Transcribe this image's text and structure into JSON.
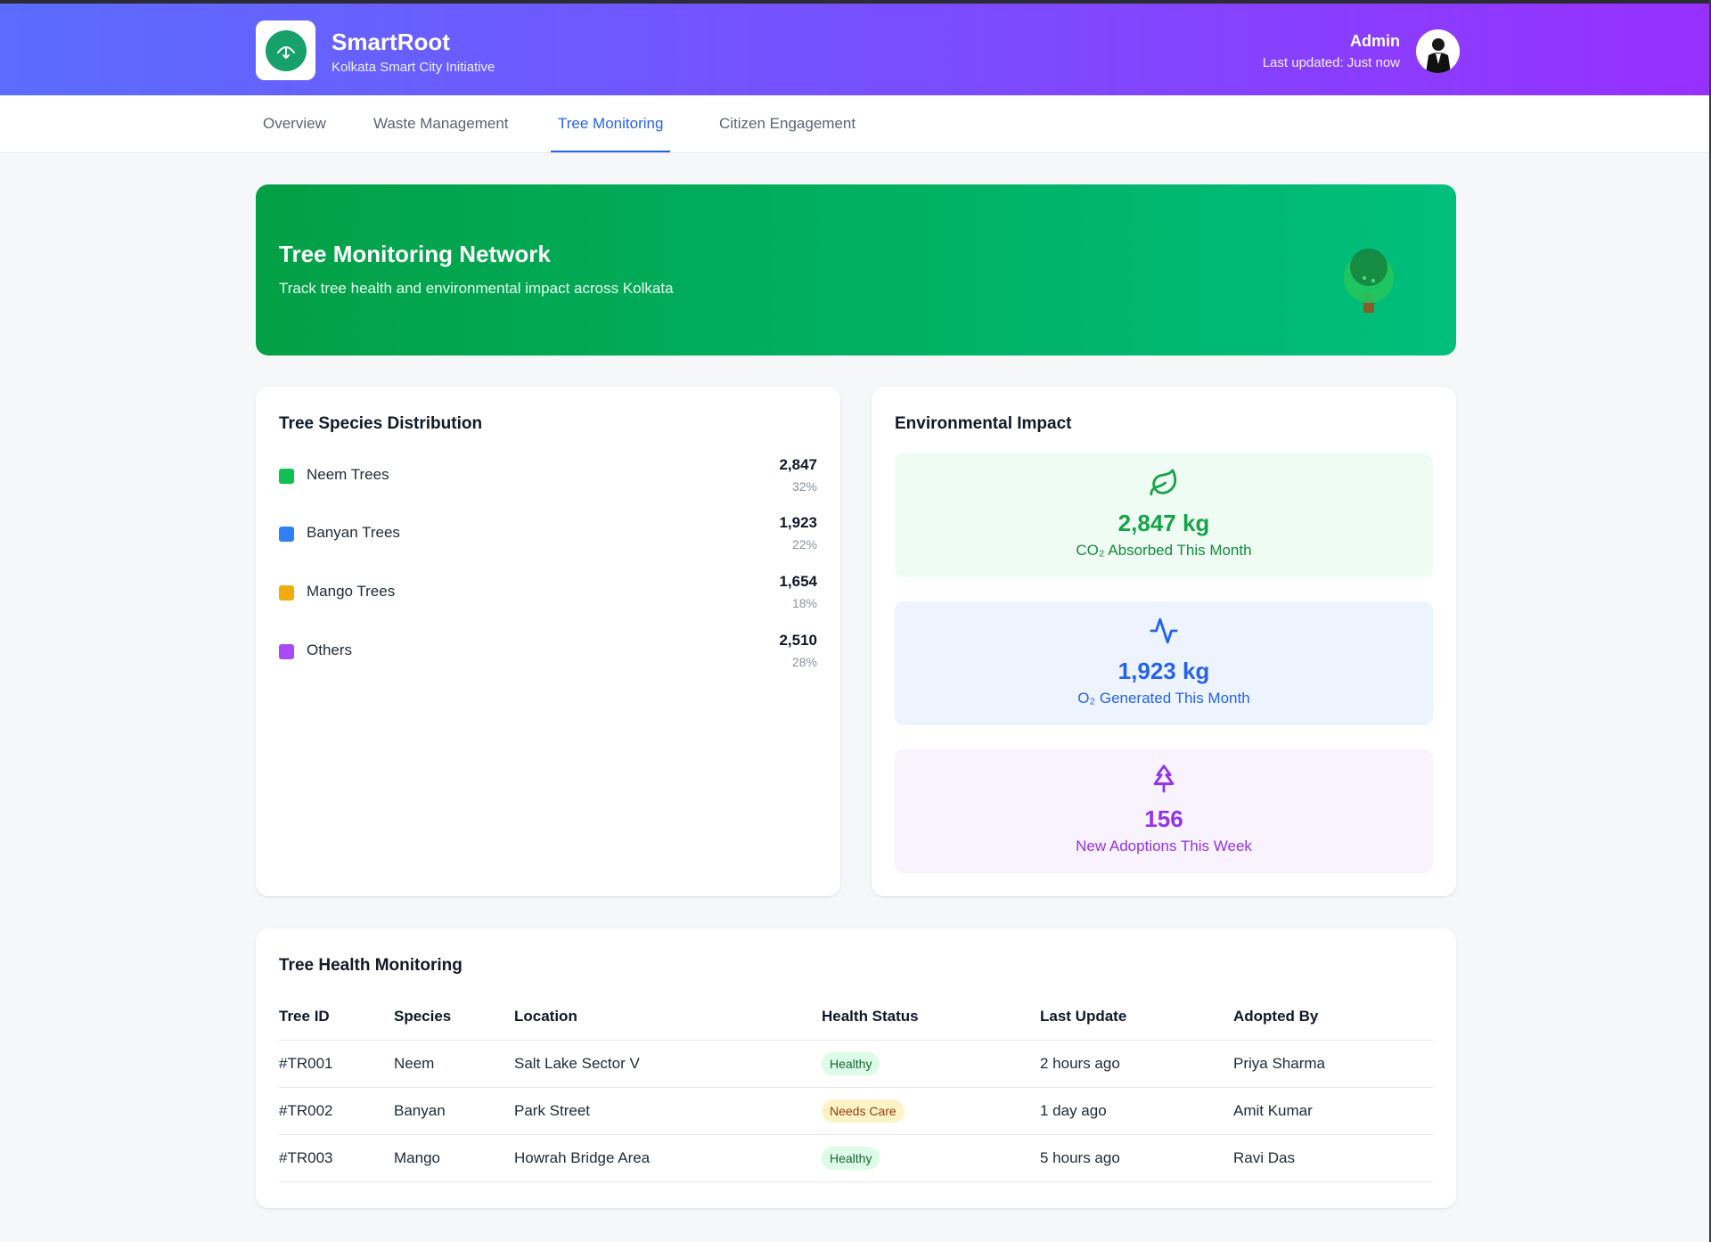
{
  "app": {
    "name": "SmartRoot",
    "subtitle": "Kolkata Smart City Initiative"
  },
  "user": {
    "name": "Admin",
    "updated": "Last updated: Just now"
  },
  "tabs": [
    {
      "label": "Overview",
      "active": false
    },
    {
      "label": "Waste Management",
      "active": false
    },
    {
      "label": "Tree Monitoring",
      "active": true
    },
    {
      "label": "Citizen Engagement",
      "active": false
    }
  ],
  "hero": {
    "title": "Tree Monitoring Network",
    "subtitle": "Track tree health and environmental impact across Kolkata",
    "icon": "tree-icon"
  },
  "species": {
    "title": "Tree Species Distribution",
    "items": [
      {
        "label": "Neem Trees",
        "count": "2,847",
        "pct": "32%",
        "color": "#0fc152"
      },
      {
        "label": "Banyan Trees",
        "count": "1,923",
        "pct": "22%",
        "color": "#2f80f7"
      },
      {
        "label": "Mango Trees",
        "count": "1,654",
        "pct": "18%",
        "color": "#efac0c"
      },
      {
        "label": "Others",
        "count": "2,510",
        "pct": "28%",
        "color": "#a94af4"
      }
    ]
  },
  "impact": {
    "title": "Environmental Impact",
    "items": [
      {
        "value": "2,847 kg",
        "label": "CO₂ Absorbed This Month",
        "icon": "leaf-icon",
        "bg": "#effcf3",
        "fg": "#16a34a",
        "label_color": "#168a40"
      },
      {
        "value": "1,923 kg",
        "label": "O₂ Generated This Month",
        "icon": "activity-icon",
        "bg": "#edf4ff",
        "fg": "#2563eb",
        "label_color": "#2563eb"
      },
      {
        "value": "156",
        "label": "New Adoptions This Week",
        "icon": "tree-outline-icon",
        "bg": "#f9f3ff",
        "fg": "#9333ea",
        "label_color": "#9333ea"
      }
    ]
  },
  "health": {
    "title": "Tree Health Monitoring",
    "columns": [
      "Tree ID",
      "Species",
      "Location",
      "Health Status",
      "Last Update",
      "Adopted By"
    ],
    "rows": [
      {
        "id": "#TR001",
        "species": "Neem",
        "location": "Salt Lake Sector V",
        "status": "Healthy",
        "status_kind": "healthy",
        "updated": "2 hours ago",
        "adopted_by": "Priya Sharma"
      },
      {
        "id": "#TR002",
        "species": "Banyan",
        "location": "Park Street",
        "status": "Needs Care",
        "status_kind": "care",
        "updated": "1 day ago",
        "adopted_by": "Amit Kumar"
      },
      {
        "id": "#TR003",
        "species": "Mango",
        "location": "Howrah Bridge Area",
        "status": "Healthy",
        "status_kind": "healthy",
        "updated": "5 hours ago",
        "adopted_by": "Ravi Das"
      }
    ]
  }
}
